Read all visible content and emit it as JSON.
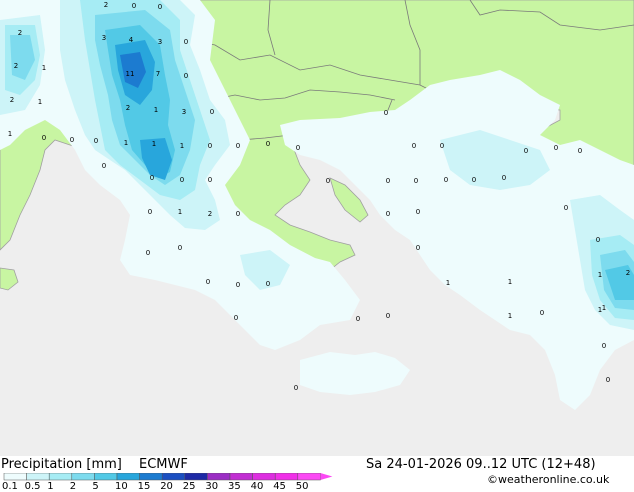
{
  "footer": {
    "title": "Precipitation [mm]",
    "model": "ECMWF",
    "datetime": "Sa 24-01-2026 09..12 UTC (12+48)",
    "credit": "©weatheronline.co.uk"
  },
  "legend": {
    "ticks": [
      "0.1",
      "0.5",
      "1",
      "2",
      "5",
      "10",
      "15",
      "20",
      "25",
      "30",
      "35",
      "40",
      "45",
      "50"
    ],
    "colors": [
      "#eefcfd",
      "#cdf4f8",
      "#a6ecf4",
      "#7ddbee",
      "#52c9e6",
      "#28a6dc",
      "#1c7bd0",
      "#1b4fc1",
      "#1e2aa6",
      "#9b2ec4",
      "#c12ed2",
      "#dd2ee0",
      "#f030e8",
      "#fb49f4"
    ]
  },
  "colors": {
    "sea": "#eeeeee",
    "land": "#c8f5a2",
    "coast": "#a0a0a0",
    "border": "#7a7a7a",
    "value_label": "#000000"
  },
  "map_values": [
    "2",
    "2",
    "0",
    "0",
    "3",
    "4",
    "3",
    "0",
    "2",
    "1",
    "11",
    "7",
    "0",
    "2",
    "1",
    "2",
    "1",
    "3",
    "0",
    "1",
    "0",
    "1",
    "1",
    "1",
    "0",
    "0",
    "0",
    "0",
    "0",
    "0",
    "0",
    "0",
    "0",
    "0",
    "0",
    "0",
    "0",
    "0",
    "0",
    "0",
    "0",
    "0",
    "0",
    "0",
    "0",
    "1",
    "2",
    "0",
    "0",
    "0",
    "0",
    "0",
    "0",
    "0",
    "0",
    "0",
    "0",
    "0",
    "0",
    "1",
    "2",
    "1",
    "1",
    "1",
    "0",
    "0",
    "0",
    "0",
    "0",
    "0",
    "0",
    "0",
    "1",
    "1"
  ]
}
